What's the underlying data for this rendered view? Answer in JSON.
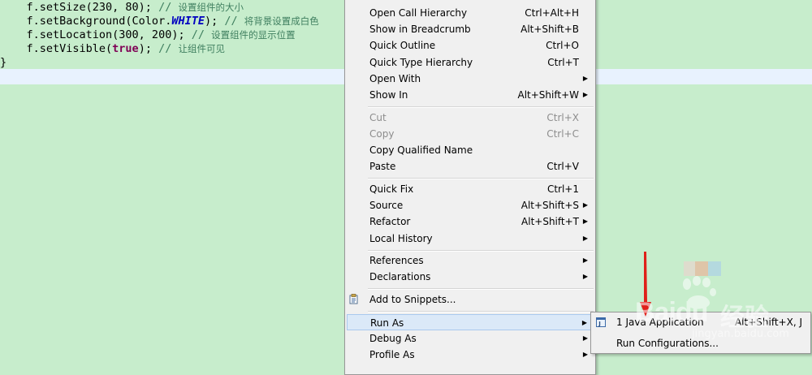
{
  "editor": {
    "lines": [
      {
        "code": "    f.setSize(230, 80);",
        "comment_marker": " // ",
        "comment_text": "设置组件的大小"
      },
      {
        "code_pre": "    f.setBackground(Color.",
        "const": "WHITE",
        "code_post": ");",
        "comment_marker": " // ",
        "comment_text": "将背景设置成白色"
      },
      {
        "code": "    f.setLocation(300, 200);",
        "comment_marker": " // ",
        "comment_text": "设置组件的显示位置"
      },
      {
        "code_pre": "    f.setVisible(",
        "kw": "true",
        "code_post": ");",
        "comment_marker": " // ",
        "comment_text": "让组件可见"
      },
      {
        "code": "}"
      }
    ]
  },
  "context_menu": {
    "items": [
      {
        "label": "Open Call Hierarchy",
        "shortcut": "Ctrl+Alt+H"
      },
      {
        "label": "Show in Breadcrumb",
        "shortcut": "Alt+Shift+B"
      },
      {
        "label": "Quick Outline",
        "shortcut": "Ctrl+O"
      },
      {
        "label": "Quick Type Hierarchy",
        "shortcut": "Ctrl+T"
      },
      {
        "label": "Open With",
        "shortcut": ""
      },
      {
        "label": "Show In",
        "shortcut": "Alt+Shift+W"
      },
      {
        "label": "Cut",
        "shortcut": "Ctrl+X"
      },
      {
        "label": "Copy",
        "shortcut": "Ctrl+C"
      },
      {
        "label": "Copy Qualified Name",
        "shortcut": ""
      },
      {
        "label": "Paste",
        "shortcut": "Ctrl+V"
      },
      {
        "label": "Quick Fix",
        "shortcut": "Ctrl+1"
      },
      {
        "label": "Source",
        "shortcut": "Alt+Shift+S"
      },
      {
        "label": "Refactor",
        "shortcut": "Alt+Shift+T"
      },
      {
        "label": "Local History",
        "shortcut": ""
      },
      {
        "label": "References",
        "shortcut": ""
      },
      {
        "label": "Declarations",
        "shortcut": ""
      },
      {
        "label": "Add to Snippets...",
        "shortcut": ""
      },
      {
        "label": "Run As",
        "shortcut": ""
      },
      {
        "label": "Debug As",
        "shortcut": ""
      },
      {
        "label": "Profile As",
        "shortcut": ""
      }
    ],
    "submenu_arrow": "▶"
  },
  "run_as_submenu": {
    "items": [
      {
        "label": "1 Java Application",
        "shortcut": "Alt+Shift+X, J"
      },
      {
        "label": "Run Configurations...",
        "shortcut": ""
      }
    ]
  },
  "watermark": {
    "brand": "Bai",
    "brand_suffix": "du",
    "cn": "经验",
    "url": "jingyan.baidu.com"
  },
  "colors": {
    "editor_bg": "#c7edcc",
    "menu_bg": "#f0f0f0",
    "hover_bg": "#dbe9f8",
    "arrow": "#e0201a"
  }
}
